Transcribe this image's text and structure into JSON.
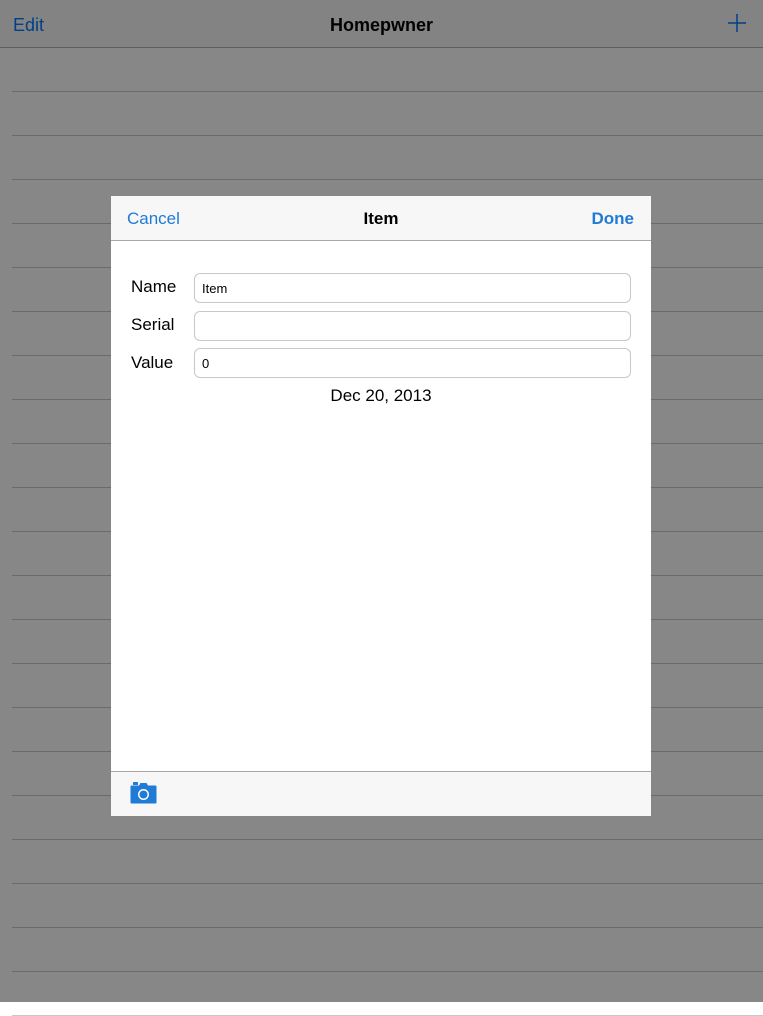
{
  "background_app": {
    "nav": {
      "edit_label": "Edit",
      "title": "Homepwner",
      "add_icon": "plus-icon"
    },
    "table_row_count": 22
  },
  "modal": {
    "nav": {
      "cancel_label": "Cancel",
      "title": "Item",
      "done_label": "Done"
    },
    "fields": {
      "name": {
        "label": "Name",
        "value": "Item"
      },
      "serial": {
        "label": "Serial",
        "value": ""
      },
      "value": {
        "label": "Value",
        "value": "0"
      }
    },
    "date_text": "Dec 20, 2013",
    "toolbar": {
      "camera_icon": "camera-icon"
    }
  },
  "colors": {
    "accent": "#1f7bd6",
    "dim_overlay": "rgba(0,0,0,0.47)",
    "bar_background": "#f7f7f7"
  }
}
